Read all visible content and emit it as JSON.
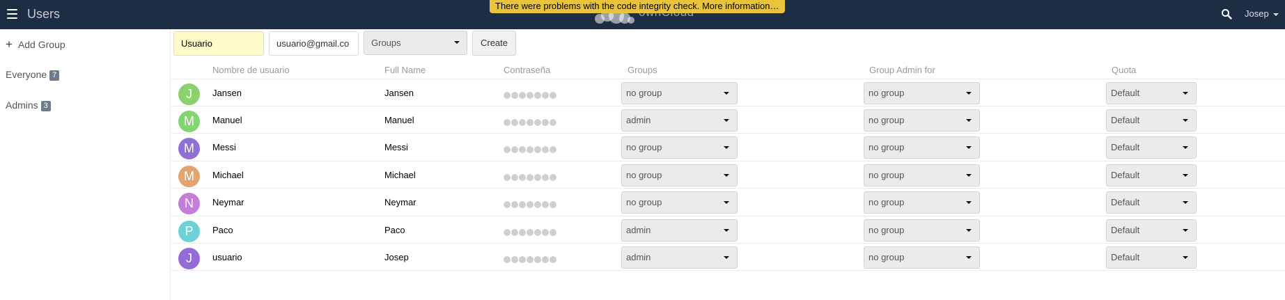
{
  "header": {
    "app_title": "Users",
    "logo_text": "ownCloud",
    "warning": "There were problems with the code integrity check. More information…",
    "user_name": "Josep"
  },
  "sidebar": {
    "add_group": "Add Group",
    "groups": [
      {
        "name": "Everyone",
        "count": "7"
      },
      {
        "name": "Admins",
        "count": "3"
      }
    ]
  },
  "create_form": {
    "username_value": "Usuario",
    "email_value": "usuario@gmail.co",
    "groups_placeholder": "Groups",
    "create_label": "Create"
  },
  "table": {
    "columns": [
      "Nombre de usuario",
      "Full Name",
      "Contraseña",
      "Groups",
      "Group Admin for",
      "Quota"
    ],
    "rows": [
      {
        "initial": "J",
        "color": "#8bd16e",
        "username": "Jansen",
        "full_name": "Jansen",
        "groups": "no group",
        "admin_for": "no group",
        "quota": "Default"
      },
      {
        "initial": "M",
        "color": "#83d472",
        "username": "Manuel",
        "full_name": "Manuel",
        "groups": "admin",
        "admin_for": "no group",
        "quota": "Default"
      },
      {
        "initial": "M",
        "color": "#8d70d8",
        "username": "Messi",
        "full_name": "Messi",
        "groups": "no group",
        "admin_for": "no group",
        "quota": "Default"
      },
      {
        "initial": "M",
        "color": "#e3a46f",
        "username": "Michael",
        "full_name": "Michael",
        "groups": "no group",
        "admin_for": "no group",
        "quota": "Default"
      },
      {
        "initial": "N",
        "color": "#c47ed8",
        "username": "Neymar",
        "full_name": "Neymar",
        "groups": "no group",
        "admin_for": "no group",
        "quota": "Default"
      },
      {
        "initial": "P",
        "color": "#6fd1d8",
        "username": "Paco",
        "full_name": "Paco",
        "groups": "admin",
        "admin_for": "no group",
        "quota": "Default"
      },
      {
        "initial": "J",
        "color": "#946bd8",
        "username": "usuario",
        "full_name": "Josep",
        "groups": "admin",
        "admin_for": "no group",
        "quota": "Default"
      }
    ]
  },
  "colors": {
    "header_bg": "#1d2d44",
    "warning_bg": "#e9c33a",
    "badge_bg": "#6d7b8c"
  },
  "icons": [
    "menu-icon",
    "search-icon",
    "plus-icon",
    "caret-down-icon",
    "owncloud-logo"
  ]
}
